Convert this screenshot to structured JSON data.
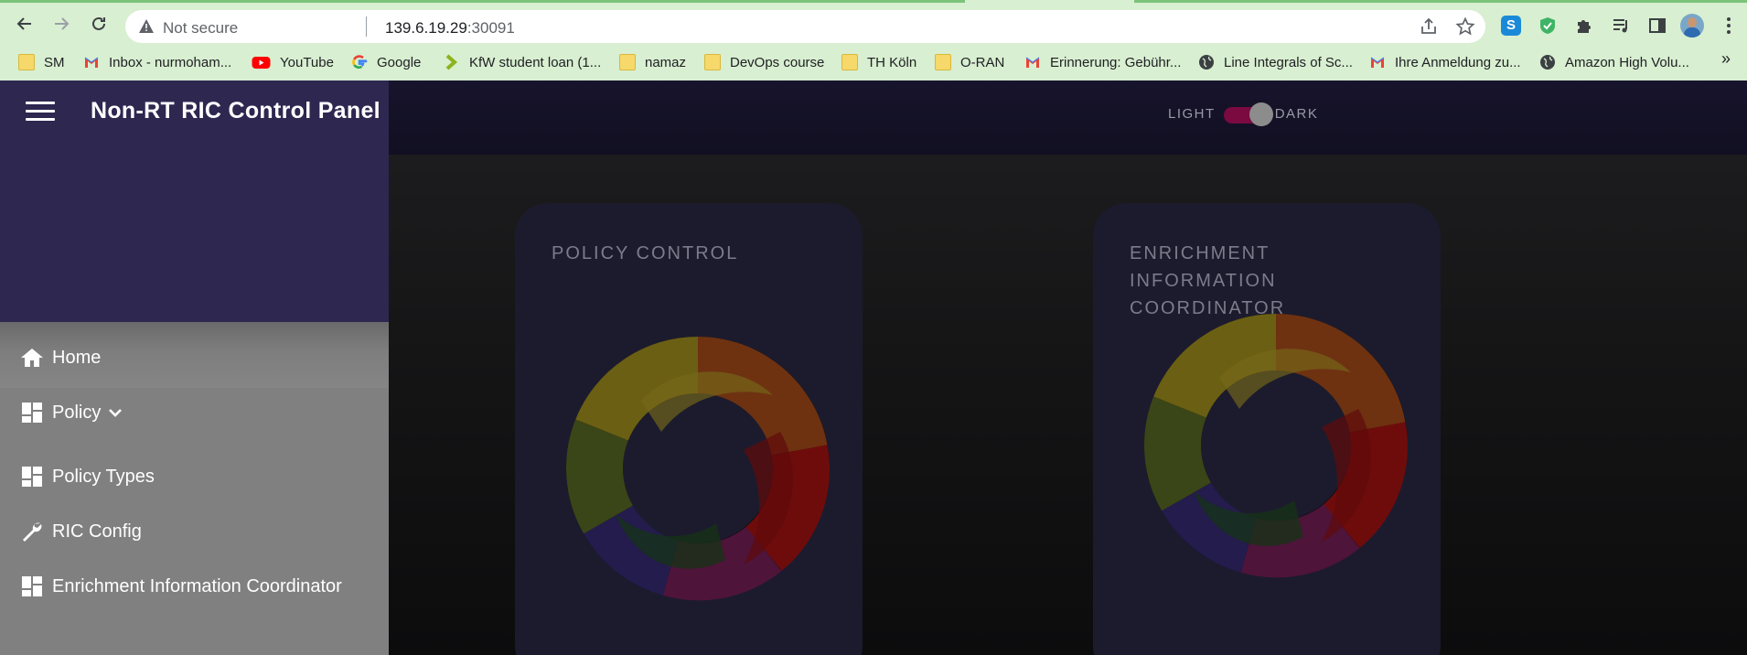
{
  "browser": {
    "security_label": "Not secure",
    "url_host": "139.6.19.29",
    "url_port": ":30091",
    "bookmarks": [
      {
        "label": "SM",
        "icon": "folder-icon"
      },
      {
        "label": "Inbox - nurmoham...",
        "icon": "gmail-icon"
      },
      {
        "label": "YouTube",
        "icon": "youtube-icon"
      },
      {
        "label": "Google",
        "icon": "google-icon"
      },
      {
        "label": "KfW student loan (1...",
        "icon": "kfw-icon"
      },
      {
        "label": "namaz",
        "icon": "folder-icon"
      },
      {
        "label": "DevOps course",
        "icon": "folder-icon"
      },
      {
        "label": "TH Köln",
        "icon": "folder-icon"
      },
      {
        "label": "O-RAN",
        "icon": "folder-icon"
      },
      {
        "label": "Erinnerung: Gebühr...",
        "icon": "gmail-icon"
      },
      {
        "label": "Line Integrals of Sc...",
        "icon": "globe-icon"
      },
      {
        "label": "Ihre Anmeldung zu...",
        "icon": "gmail-icon"
      },
      {
        "label": "Amazon High Volu...",
        "icon": "globe-icon"
      }
    ],
    "more_bookmarks": "»"
  },
  "app": {
    "title": "Non-RT RIC Control Panel",
    "theme": {
      "light_label": "LIGHT",
      "dark_label": "DARK",
      "dark_enabled": true
    },
    "nav": [
      {
        "label": "Home",
        "icon": "home-icon"
      },
      {
        "label": "Policy",
        "icon": "dashboard-icon",
        "expandable": true
      },
      {
        "label": "Policy Types",
        "icon": "dashboard-icon"
      },
      {
        "label": "RIC Config",
        "icon": "wrench-icon"
      },
      {
        "label": "Enrichment Information Coordinator",
        "icon": "dashboard-icon"
      }
    ],
    "cards": [
      {
        "title": "POLICY CONTROL",
        "logo": "ring-logo"
      },
      {
        "title": "ENRICHMENT INFORMATION COORDINATOR",
        "logo": "ring-logo"
      }
    ]
  },
  "colors": {
    "sidebar_header": "#2e2750",
    "sidebar_nav": "#808080",
    "toggle_track": "#7a0a40",
    "card_bg": "#1c1b2d"
  }
}
